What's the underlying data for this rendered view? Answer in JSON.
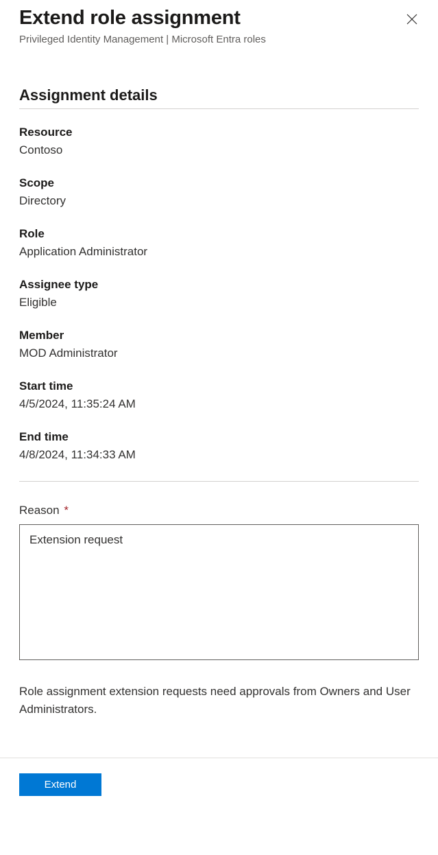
{
  "header": {
    "title": "Extend role assignment",
    "subtitle": "Privileged Identity Management | Microsoft Entra roles"
  },
  "section_heading": "Assignment details",
  "fields": {
    "resource": {
      "label": "Resource",
      "value": "Contoso"
    },
    "scope": {
      "label": "Scope",
      "value": "Directory"
    },
    "role": {
      "label": "Role",
      "value": "Application Administrator"
    },
    "assignee_type": {
      "label": "Assignee type",
      "value": "Eligible"
    },
    "member": {
      "label": "Member",
      "value": "MOD Administrator"
    },
    "start_time": {
      "label": "Start time",
      "value": "4/5/2024, 11:35:24 AM"
    },
    "end_time": {
      "label": "End time",
      "value": "4/8/2024, 11:34:33 AM"
    }
  },
  "reason": {
    "label": "Reason",
    "required_marker": "*",
    "value": "Extension request"
  },
  "info_text": "Role assignment extension requests need approvals from Owners and User Administrators.",
  "footer": {
    "extend_label": "Extend"
  }
}
